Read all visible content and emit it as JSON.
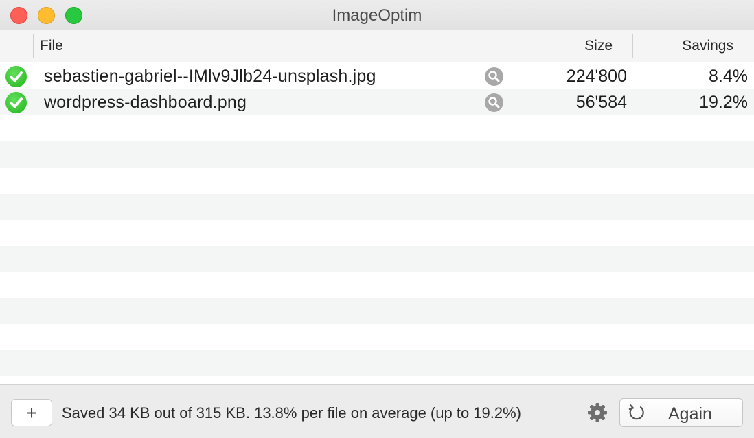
{
  "window": {
    "title": "ImageOptim"
  },
  "columns": {
    "file": "File",
    "size": "Size",
    "savings": "Savings"
  },
  "files": [
    {
      "name": "sebastien-gabriel--IMlv9Jlb24-unsplash.jpg",
      "size": "224'800",
      "savings": "8.4%",
      "status": "done",
      "status_icon": "checkmark-icon"
    },
    {
      "name": "wordpress-dashboard.png",
      "size": "56'584",
      "savings": "19.2%",
      "status": "done",
      "status_icon": "checkmark-icon"
    }
  ],
  "status_text": "Saved 34 KB out of 315 KB. 13.8% per file on average (up to 19.2%)",
  "buttons": {
    "add": "+",
    "again": "Again"
  },
  "icons": {
    "add": "plus-icon",
    "settings": "gear-icon",
    "again": "refresh-icon",
    "reveal": "magnifier-icon"
  },
  "colors": {
    "success": "#2ac024",
    "close": "#fe5f57",
    "minimize": "#febc2e",
    "zoom": "#28c840"
  }
}
